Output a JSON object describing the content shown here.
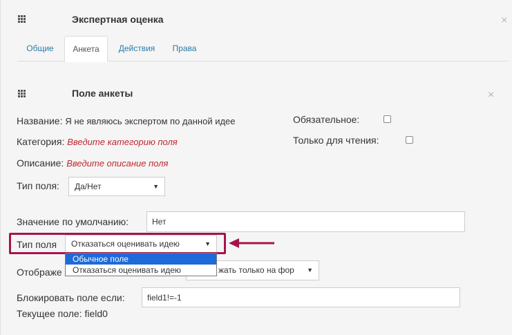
{
  "dialog": {
    "title": "Экспертная оценка",
    "close": "×"
  },
  "tabs": [
    {
      "label": "Общие"
    },
    {
      "label": "Анкета"
    },
    {
      "label": "Действия"
    },
    {
      "label": "Права"
    }
  ],
  "active_tab": "Анкета",
  "panel": {
    "title": "Поле анкеты",
    "close": "×"
  },
  "fields": {
    "name_label": "Название:",
    "name_value": "Я не являюсь экспертом по данной идее",
    "category_label": "Категория:",
    "category_hint": "Введите категорию поля",
    "description_label": "Описание:",
    "description_hint": "Введите описание поля",
    "required_label": "Обязательное:",
    "readonly_label": "Только для чтения:",
    "type_label": "Тип поля:",
    "type_value": "Да/Нет",
    "default_label": "Значение по умолчанию:",
    "default_value": "Нет",
    "field_type2_label": "Тип поля",
    "field_type2_value": "Отказаться оценивать идею",
    "display_label": "Отображе",
    "display_value": "жать только на фор",
    "block_label": "Блокировать поле если:",
    "block_value": "field1!=-1",
    "current_field": "Текущее поле: field0"
  },
  "dropdown_options": [
    {
      "label": "Обычное поле",
      "selected": true
    },
    {
      "label": "Отказаться оценивать идею",
      "selected": false
    }
  ],
  "colors": {
    "highlight": "#a6134b",
    "link": "#2a7ca8",
    "hint": "#c0282d",
    "selected_option": "#1e6ad8"
  },
  "icons": {
    "grip": "grip-icon",
    "close": "close-icon",
    "caret": "caret-down-icon",
    "arrow": "arrow-left-icon"
  }
}
